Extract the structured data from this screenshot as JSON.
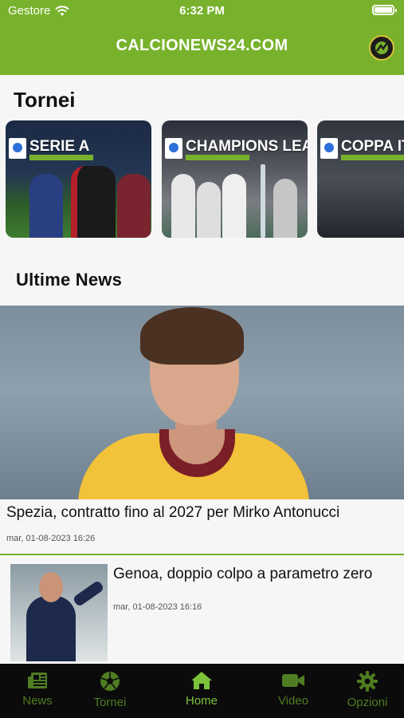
{
  "status_bar": {
    "carrier": "Gestore",
    "time": "6:32 PM"
  },
  "header": {
    "title": "CALCIONEWS24.COM",
    "logo_icon": "brand-logo-icon"
  },
  "sections": {
    "tournaments_title": "Tornei",
    "news_title": "Ultime News"
  },
  "tournaments": [
    {
      "label": "SERIE A"
    },
    {
      "label": "CHAMPIONS LEAGUE"
    },
    {
      "label": "COPPA IT"
    }
  ],
  "news": [
    {
      "title": "Spezia, contratto fino al 2027 per Mirko Antonucci",
      "date": "mar, 01-08-2023 16:26"
    },
    {
      "title": "Genoa, doppio colpo a parametro zero",
      "date": "mar, 01-08-2023 16:16"
    }
  ],
  "tabs": [
    {
      "label": "News",
      "icon": "newspaper-icon"
    },
    {
      "label": "Tornei",
      "icon": "soccer-ball-icon"
    },
    {
      "label": "Home",
      "icon": "home-icon"
    },
    {
      "label": "Video",
      "icon": "video-camera-icon"
    },
    {
      "label": "Opzioni",
      "icon": "gear-icon"
    }
  ],
  "colors": {
    "brand_green": "#78b22c",
    "tab_active": "#7bc23a",
    "tab_inactive": "#4e7d22"
  }
}
